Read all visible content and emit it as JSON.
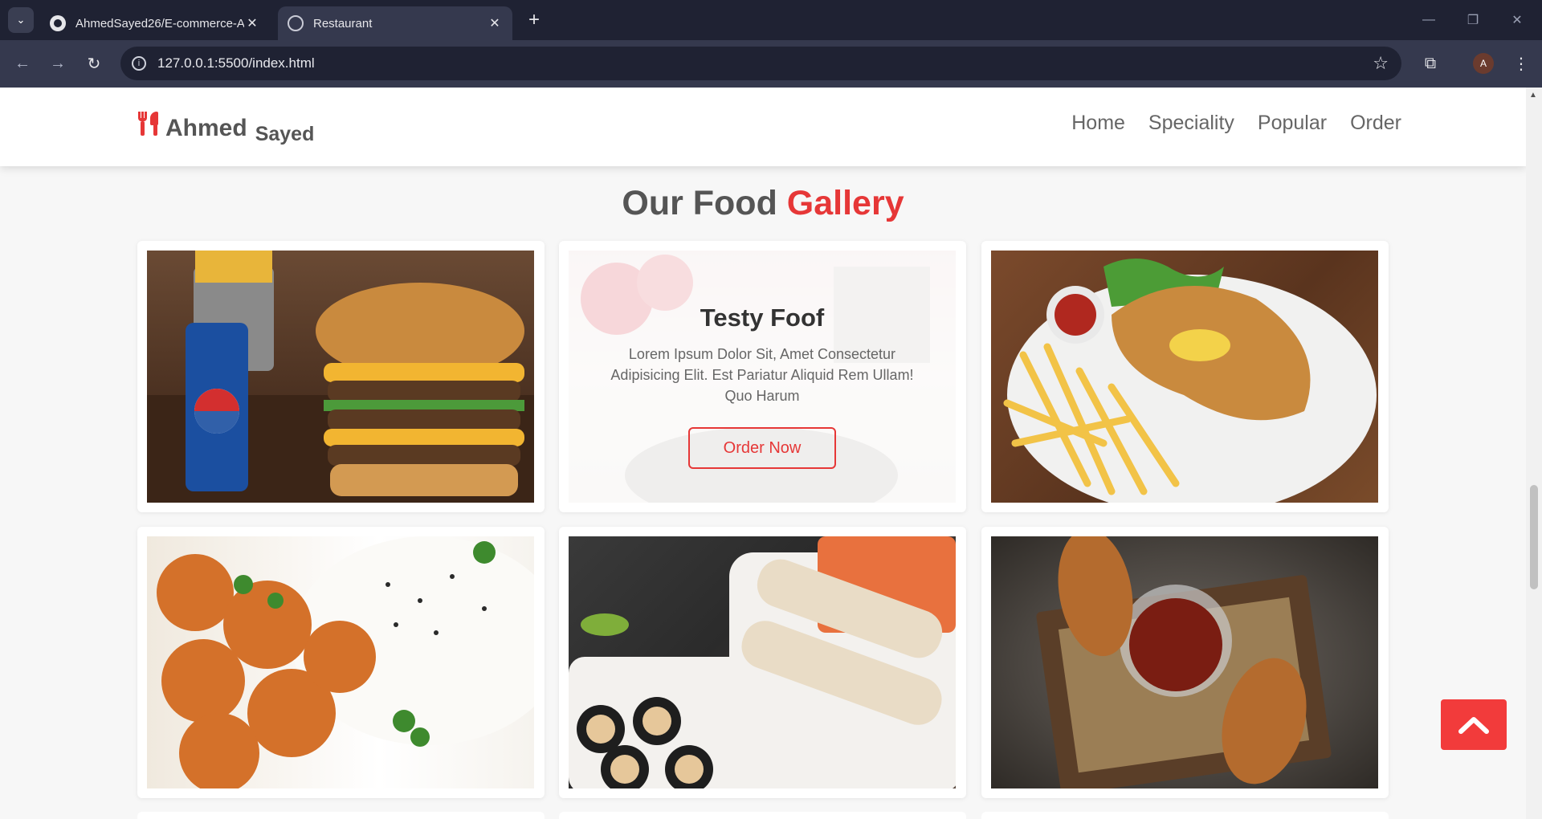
{
  "browser": {
    "tabs": [
      {
        "title": "AhmedSayed26/E-commerce-A",
        "icon": "github-icon"
      },
      {
        "title": "Restaurant",
        "icon": "globe-icon"
      }
    ],
    "url": "127.0.0.1:5500/index.html",
    "profile_initial": "A"
  },
  "header": {
    "logo_main": "Ahmed",
    "logo_sub": "Sayed",
    "nav": [
      "Home",
      "Speciality",
      "Popular",
      "Order"
    ]
  },
  "gallery": {
    "title_part1": "Our Food",
    "title_part2": "Gallery",
    "overlay": {
      "title": "Testy Foof",
      "text": "Lorem Ipsum Dolor Sit, Amet Consectetur Adipisicing Elit. Est Pariatur Aliquid Rem Ullam! Quo Harum",
      "button": "Order Now"
    }
  },
  "colors": {
    "accent": "#e63737",
    "text_dark": "#555555",
    "scroll_top_button": "#f23b3b"
  }
}
